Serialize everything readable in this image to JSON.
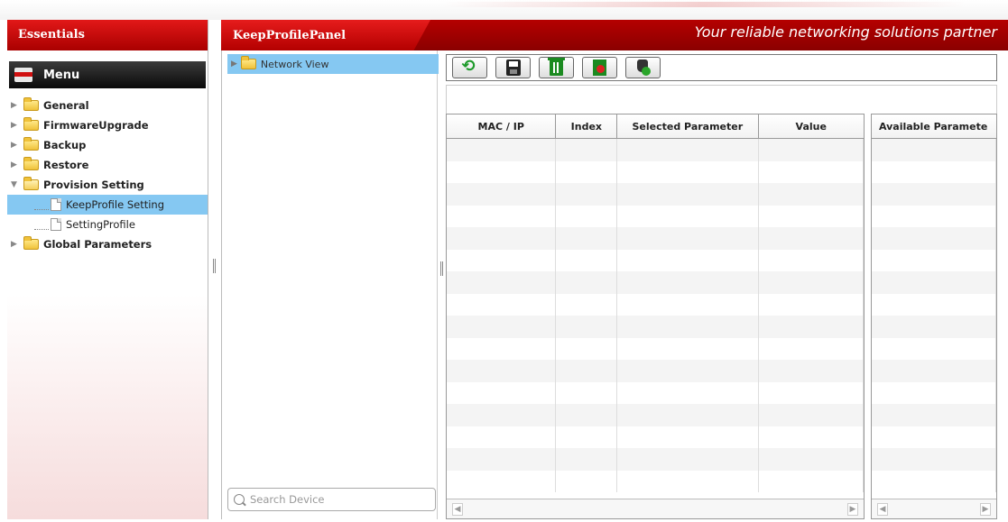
{
  "sidebar": {
    "title": "Essentials",
    "menu_label": "Menu",
    "items": [
      {
        "label": "General",
        "expanded": false
      },
      {
        "label": "FirmwareUpgrade",
        "expanded": false
      },
      {
        "label": "Backup",
        "expanded": false
      },
      {
        "label": "Restore",
        "expanded": false
      },
      {
        "label": "Provision Setting",
        "expanded": true,
        "children": [
          {
            "label": "KeepProfile Setting",
            "selected": true
          },
          {
            "label": "SettingProfile",
            "selected": false
          }
        ]
      },
      {
        "label": "Global Parameters",
        "expanded": false
      }
    ]
  },
  "header": {
    "panel_title": "KeepProfilePanel",
    "slogan": "Your reliable networking solutions partner"
  },
  "network_tree": {
    "root_label": "Network View"
  },
  "search": {
    "placeholder": "Search Device"
  },
  "toolbar": {
    "buttons": [
      {
        "name": "refresh",
        "icon": "refresh-icon"
      },
      {
        "name": "save",
        "icon": "save-icon"
      },
      {
        "name": "delete",
        "icon": "trash-icon"
      },
      {
        "name": "delete-selected",
        "icon": "trash-remove-icon"
      },
      {
        "name": "apply",
        "icon": "hand-check-icon"
      }
    ]
  },
  "grid": {
    "columns": [
      "MAC / IP",
      "Index",
      "Selected Parameter",
      "Value"
    ],
    "rows": []
  },
  "available_grid": {
    "columns": [
      "Available Paramete"
    ],
    "rows": []
  },
  "colors": {
    "brand_red": "#c40000",
    "selection_blue": "#85c8f2"
  }
}
